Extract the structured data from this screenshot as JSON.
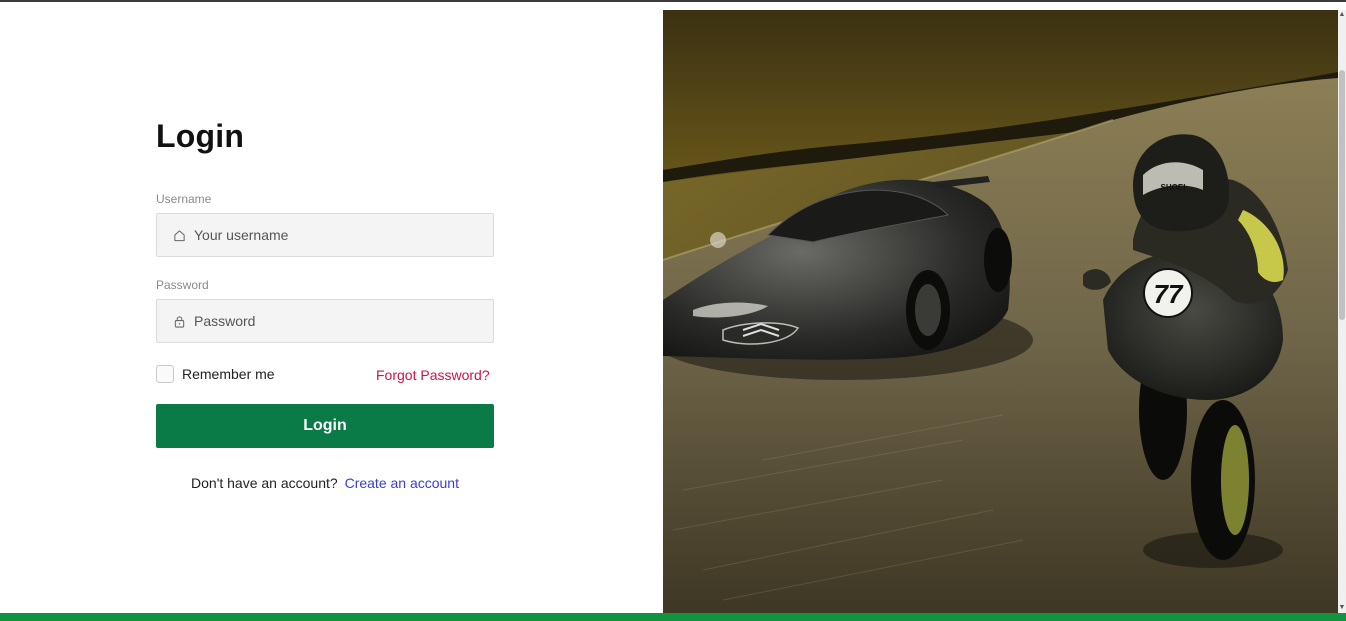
{
  "form": {
    "title": "Login",
    "username_label": "Username",
    "username_placeholder": "Your username",
    "password_label": "Password",
    "password_placeholder": "Password",
    "remember_label": "Remember me",
    "forgot_link": "Forgot Password?",
    "login_button": "Login",
    "signup_prompt": "Don't have an account?",
    "signup_link": "Create an account"
  },
  "hero": {
    "image_icon": "sports-car-and-motorcycle-racing-photo"
  },
  "colors": {
    "primary_button": "#0a7a47",
    "forgot_link": "#d0114a",
    "signup_link": "#3a3ecf",
    "footer_bar": "#12933f"
  },
  "icons": {
    "username": "home-icon",
    "password": "lock-icon"
  }
}
